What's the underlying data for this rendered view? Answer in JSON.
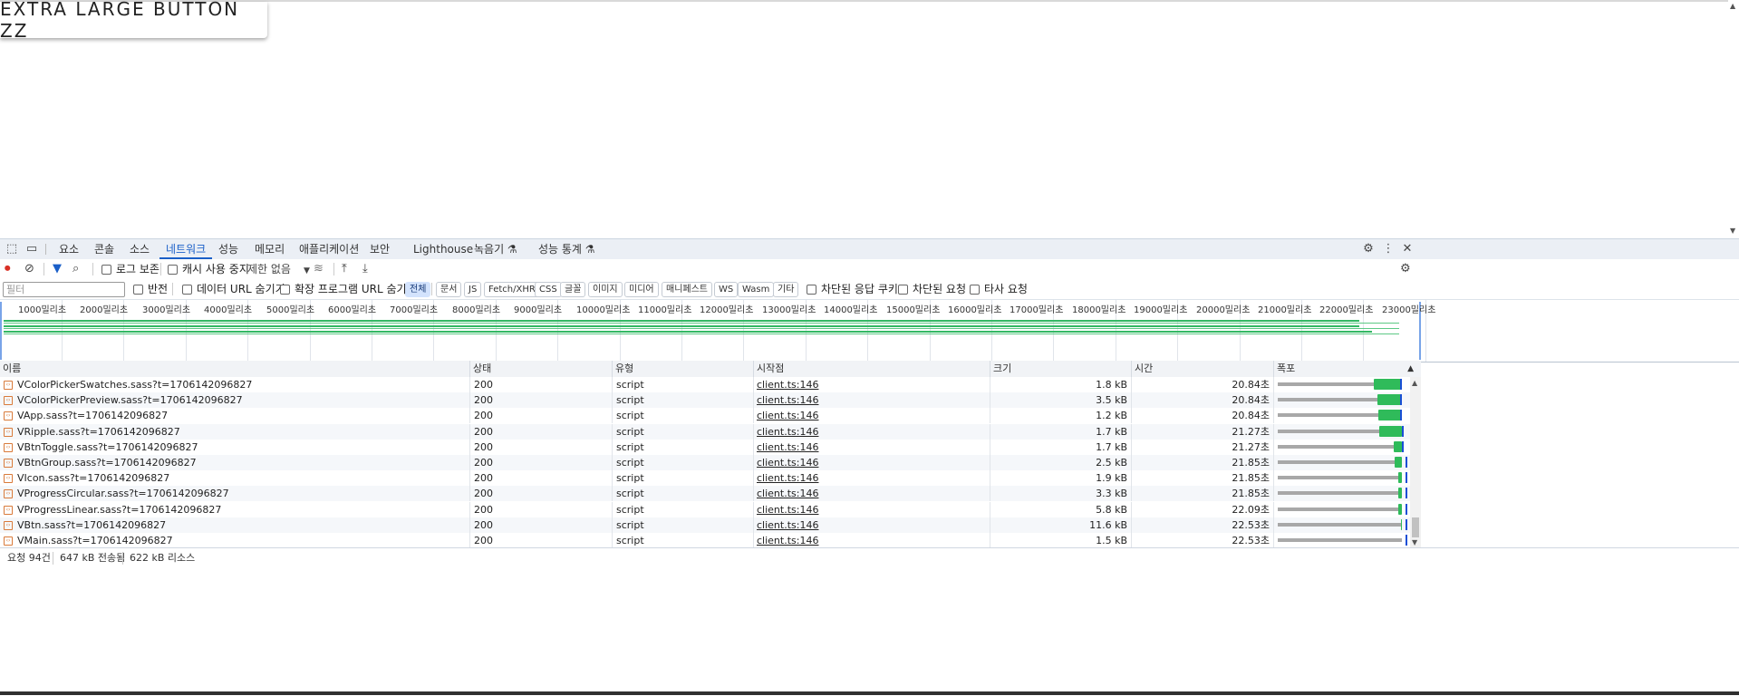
{
  "page": {
    "button_label": "EXTRA LARGE BUTTON ZZ"
  },
  "tabs": [
    {
      "label": "요소"
    },
    {
      "label": "콘솔"
    },
    {
      "label": "소스"
    },
    {
      "label": "네트워크"
    },
    {
      "label": "성능"
    },
    {
      "label": "메모리"
    },
    {
      "label": "애플리케이션"
    },
    {
      "label": "보안"
    },
    {
      "label": "Lighthouse"
    },
    {
      "label": "녹음기 ⚗"
    },
    {
      "label": "성능 통계 ⚗"
    }
  ],
  "active_tab": "네트워크",
  "toolbar": {
    "preserve_log": "로그 보존",
    "disable_cache": "캐시 사용 중지",
    "throttle": "제한 없음"
  },
  "filterbar": {
    "filter_placeholder": "필터",
    "invert": "반전",
    "hide_data_urls": "데이터 URL 숨기기",
    "hide_ext_urls": "확장 프로그램 URL 숨기기",
    "types": [
      "전체",
      "문서",
      "JS",
      "Fetch/XHR",
      "CSS",
      "글꼴",
      "이미지",
      "미디어",
      "매니페스트",
      "WS",
      "Wasm",
      "기타"
    ],
    "blocked_cookies": "차단된 응답 쿠키",
    "blocked_requests": "차단된 요청",
    "third_party": "타사 요청"
  },
  "overview_ticks": [
    "1000밀리초",
    "2000밀리초",
    "3000밀리초",
    "4000밀리초",
    "5000밀리초",
    "6000밀리초",
    "7000밀리초",
    "8000밀리초",
    "9000밀리초",
    "10000밀리초",
    "11000밀리초",
    "12000밀리초",
    "13000밀리초",
    "14000밀리초",
    "15000밀리초",
    "16000밀리초",
    "17000밀리초",
    "18000밀리초",
    "19000밀리초",
    "20000밀리초",
    "21000밀리초",
    "22000밀리초",
    "23000밀리초"
  ],
  "columns": {
    "name": "이름",
    "status": "상태",
    "type": "유형",
    "initiator": "시작점",
    "size": "크기",
    "time": "시간",
    "waterfall": "폭포"
  },
  "rows": [
    {
      "name": "VColorPickerSwatches.sass?t=1706142096827",
      "status": "200",
      "type": "script",
      "initiator": "client.ts:146",
      "size": "1.8 kB",
      "time": "20.84초"
    },
    {
      "name": "VColorPickerPreview.sass?t=1706142096827",
      "status": "200",
      "type": "script",
      "initiator": "client.ts:146",
      "size": "3.5 kB",
      "time": "20.84초"
    },
    {
      "name": "VApp.sass?t=1706142096827",
      "status": "200",
      "type": "script",
      "initiator": "client.ts:146",
      "size": "1.2 kB",
      "time": "20.84초"
    },
    {
      "name": "VRipple.sass?t=1706142096827",
      "status": "200",
      "type": "script",
      "initiator": "client.ts:146",
      "size": "1.7 kB",
      "time": "21.27초"
    },
    {
      "name": "VBtnToggle.sass?t=1706142096827",
      "status": "200",
      "type": "script",
      "initiator": "client.ts:146",
      "size": "1.7 kB",
      "time": "21.27초"
    },
    {
      "name": "VBtnGroup.sass?t=1706142096827",
      "status": "200",
      "type": "script",
      "initiator": "client.ts:146",
      "size": "2.5 kB",
      "time": "21.85초"
    },
    {
      "name": "VIcon.sass?t=1706142096827",
      "status": "200",
      "type": "script",
      "initiator": "client.ts:146",
      "size": "1.9 kB",
      "time": "21.85초"
    },
    {
      "name": "VProgressCircular.sass?t=1706142096827",
      "status": "200",
      "type": "script",
      "initiator": "client.ts:146",
      "size": "3.3 kB",
      "time": "21.85초"
    },
    {
      "name": "VProgressLinear.sass?t=1706142096827",
      "status": "200",
      "type": "script",
      "initiator": "client.ts:146",
      "size": "5.8 kB",
      "time": "22.09초"
    },
    {
      "name": "VBtn.sass?t=1706142096827",
      "status": "200",
      "type": "script",
      "initiator": "client.ts:146",
      "size": "11.6 kB",
      "time": "22.53초"
    },
    {
      "name": "VMain.sass?t=1706142096827",
      "status": "200",
      "type": "script",
      "initiator": "client.ts:146",
      "size": "1.5 kB",
      "time": "22.53초"
    }
  ],
  "status_bar": {
    "requests": "요청 94건",
    "transferred": "647 kB 전송됨",
    "resources": "622 kB 리소스"
  },
  "colors": {
    "accent": "#1a5fc8",
    "waterfall_green": "#2fbb5a",
    "waterfall_wait": "#a8a8a8"
  }
}
